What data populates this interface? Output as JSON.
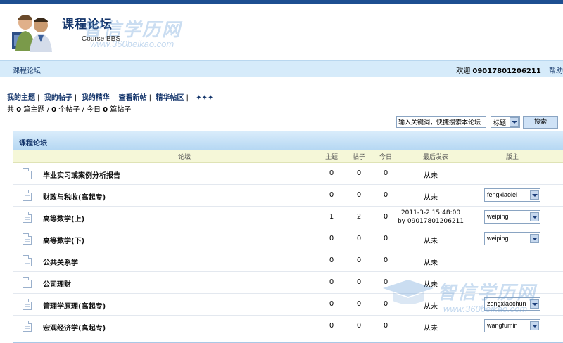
{
  "header": {
    "title": "课程论坛",
    "subtitle": "Course BBS",
    "watermark_text": "智信学历网",
    "watermark_url": "www.360beikao.com"
  },
  "navbar": {
    "breadcrumb": "课程论坛",
    "welcome_label": "欢迎",
    "username": "09017801206211",
    "help_label": "帮助"
  },
  "links": [
    "我的主题",
    "我的帖子",
    "我的精华",
    "查看新帖",
    "精华帖区"
  ],
  "links_more": "✦✦✦",
  "stats": {
    "prefix": "共",
    "topics": "0",
    "topics_label": "篇主题 /",
    "posts": "0",
    "posts_label": "个帖子 / 今日",
    "today": "0",
    "today_label": "篇帖子"
  },
  "search": {
    "placeholder": "输入关键词，快捷搜索本论坛",
    "scope": "标题",
    "button": "搜索"
  },
  "panel": {
    "title": "课程论坛",
    "columns": {
      "forum": "论坛",
      "topics": "主题",
      "posts": "帖子",
      "today": "今日",
      "last": "最后发表",
      "moderator": "版主"
    }
  },
  "forums": [
    {
      "name": "毕业实习或案例分析报告",
      "topics": "0",
      "posts": "0",
      "today": "0",
      "last": "从未",
      "last_by": "",
      "moderator": ""
    },
    {
      "name": "财政与税收(高起专)",
      "topics": "0",
      "posts": "0",
      "today": "0",
      "last": "从未",
      "last_by": "",
      "moderator": "fengxiaolei"
    },
    {
      "name": "高等数学(上)",
      "topics": "1",
      "posts": "2",
      "today": "0",
      "last": "2011-3-2 15:48:00",
      "last_by": "by 09017801206211",
      "moderator": "weiping"
    },
    {
      "name": "高等数学(下)",
      "topics": "0",
      "posts": "0",
      "today": "0",
      "last": "从未",
      "last_by": "",
      "moderator": "weiping"
    },
    {
      "name": "公共关系学",
      "topics": "0",
      "posts": "0",
      "today": "0",
      "last": "从未",
      "last_by": "",
      "moderator": ""
    },
    {
      "name": "公司理财",
      "topics": "0",
      "posts": "0",
      "today": "0",
      "last": "从未",
      "last_by": "",
      "moderator": ""
    },
    {
      "name": "管理学原理(高起专)",
      "topics": "0",
      "posts": "0",
      "today": "0",
      "last": "从未",
      "last_by": "",
      "moderator": "zengxiaochun"
    },
    {
      "name": "宏观经济学(高起专)",
      "topics": "0",
      "posts": "0",
      "today": "0",
      "last": "从未",
      "last_by": "",
      "moderator": "wangfumin"
    }
  ]
}
